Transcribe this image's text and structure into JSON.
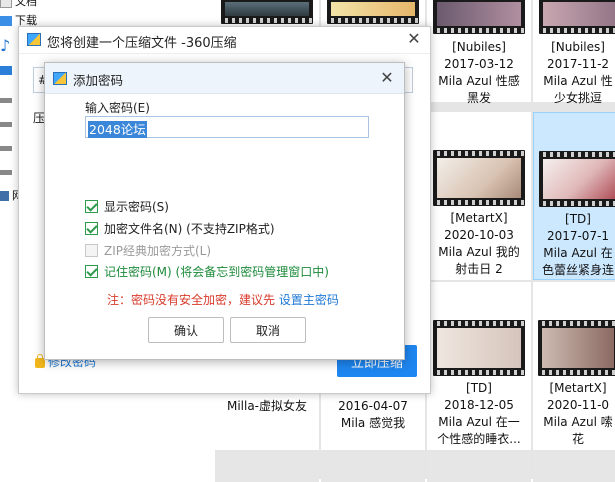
{
  "explorer": {
    "nav": [
      {
        "label": "文档",
        "icon": "document-icon"
      },
      {
        "label": "下载",
        "icon": "download-icon"
      },
      {
        "label": "",
        "icon": "music-icon"
      },
      {
        "label": "",
        "icon": "desktop-icon"
      },
      {
        "label": "",
        "icon": "drive-icon"
      },
      {
        "label": "",
        "icon": "drive-icon"
      },
      {
        "label": "",
        "icon": "drive-icon"
      },
      {
        "label": "",
        "icon": "drive-icon"
      },
      {
        "label": "网",
        "icon": "network-icon"
      }
    ],
    "cells": {
      "r1c1": {
        "line1": "",
        "line2": "",
        "line3": ""
      },
      "r1c2": {
        "line1": "",
        "line2": "",
        "line3": ""
      },
      "r1c3": {
        "line1": "[Nubiles]",
        "line2": "2017-03-12",
        "line3": "Mila Azul 性感",
        "line4": "黑发"
      },
      "r1c4": {
        "line1": "[Nubiles]",
        "line2": "2017-11-2",
        "line3": "Mila Azul 性",
        "line4": "少女挑逗"
      },
      "r2c3": {
        "line1": "[MetartX]",
        "line2": "2020-10-03",
        "line3": "Mila Azul  我的",
        "line4": "射击日 2"
      },
      "r2c4": {
        "line1": "[TD]",
        "line2": "2017-07-1",
        "line3": "Mila Azul 在",
        "line4": "色蕾丝紧身连"
      },
      "r3c1": {
        "line1": "Milla-虚拟女友"
      },
      "r3c2": {
        "line1": "2016-04-07",
        "line2": "Mila 感觉我"
      },
      "r3c3": {
        "line1": "[TD]",
        "line2": "2018-12-05",
        "line3": "Mila Azul  在一",
        "line4": "个性感的睡衣..."
      },
      "r3c4": {
        "line1": "[MetartX]",
        "line2": "2020-11-0",
        "line3": "Mila Azul  嗦",
        "line4": "花"
      }
    }
  },
  "compress_window": {
    "title": "您将创建一个压缩文件 -360压缩",
    "field_prefix": "#",
    "side_label": "压",
    "modify_password": "修改密码",
    "compress_now": "立即压缩"
  },
  "password_dialog": {
    "title": "添加密码",
    "input_label": "输入密码(E)",
    "password_value": "2048论坛",
    "options": {
      "show_password": "显示密码(S)",
      "encrypt_filenames": "加密文件名(N) (不支持ZIP格式)",
      "zip_classic": "ZIP经典加密方式(L)",
      "remember_password": "记住密码(M) (将会备忘到密码管理窗口中)"
    },
    "warning": "注：密码没有安全加密，建议先 ",
    "warning_link": "设置主密码",
    "ok": "确认",
    "cancel": "取消"
  },
  "colors": {
    "accent": "#1e86f0",
    "checkbox_green": "#2e9a4c",
    "warning_red": "#d93a2b",
    "link_blue": "#1e78d6"
  }
}
